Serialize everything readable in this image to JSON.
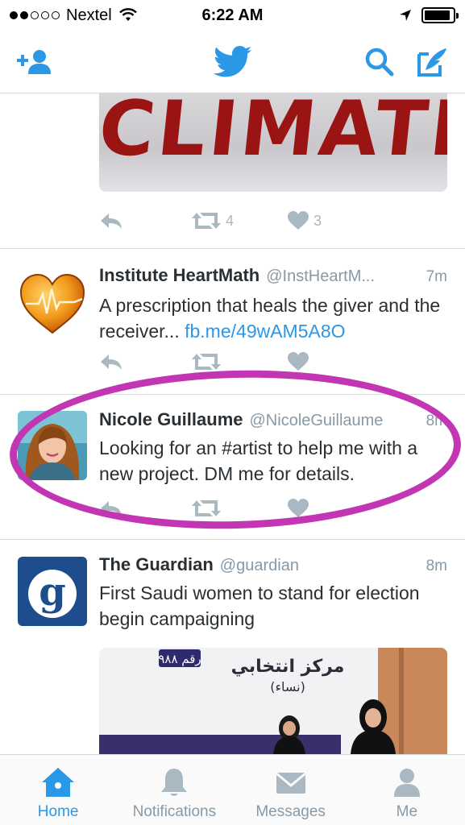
{
  "status_bar": {
    "carrier": "Nextel",
    "time": "6:22 AM",
    "battery_level": 0.9
  },
  "nav": {
    "icons": [
      "add-user-icon",
      "twitter-bird-icon",
      "search-icon",
      "compose-icon"
    ],
    "accent_color": "#2b97e7"
  },
  "tweets": [
    {
      "media_text": "CLIMATE",
      "retweets": "4",
      "likes": "3"
    },
    {
      "display_name": "Institute HeartMath",
      "handle": "@InstHeartM...",
      "time": "7m",
      "text": "A prescription that heals the giver and the receiver...",
      "link": "fb.me/49wAM5A8O"
    },
    {
      "display_name": "Nicole Guillaume",
      "handle": "@NicoleGuillaume",
      "time": "8m",
      "text": "Looking for an #artist to help me with a new project. DM me for details."
    },
    {
      "display_name": "The Guardian",
      "handle": "@guardian",
      "time": "8m",
      "text": "First Saudi women to stand for election begin campaigning",
      "media_text": "مركز انتخابي",
      "media_sub": "(نساء)",
      "media_badge": "رقم ٩٨٨"
    }
  ],
  "tabs": [
    {
      "label": "Home",
      "icon": "home-icon",
      "active": true
    },
    {
      "label": "Notifications",
      "icon": "bell-icon",
      "active": false
    },
    {
      "label": "Messages",
      "icon": "envelope-icon",
      "active": false
    },
    {
      "label": "Me",
      "icon": "person-icon",
      "active": false
    }
  ],
  "highlight_color": "#c236b3"
}
